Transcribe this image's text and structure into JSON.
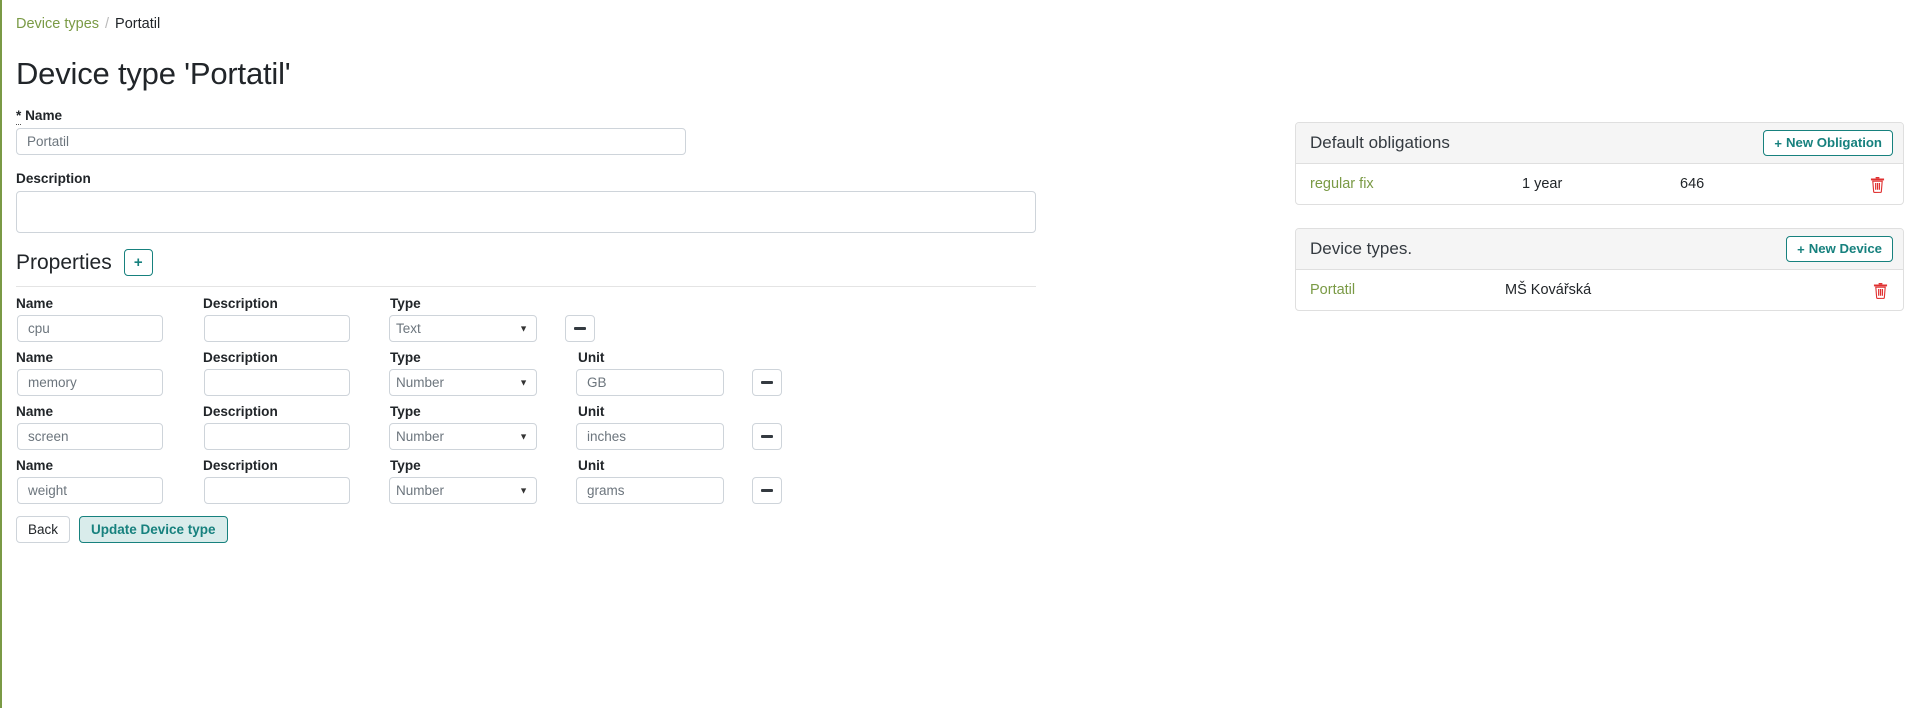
{
  "breadcrumb": {
    "root_label": "Device types",
    "separator": "/",
    "current_label": "Portatil"
  },
  "page_title": "Device type 'Portatil'",
  "form": {
    "name_label_star": "*",
    "name_label": "Name",
    "name_value": "Portatil",
    "description_label": "Description",
    "description_value": "",
    "properties_title": "Properties",
    "add_property_label": "+",
    "column_labels": {
      "name": "Name",
      "description": "Description",
      "type": "Type",
      "unit": "Unit"
    },
    "properties": [
      {
        "name": "cpu",
        "description": "",
        "type": "Text",
        "has_unit": false,
        "unit": ""
      },
      {
        "name": "memory",
        "description": "",
        "type": "Number",
        "has_unit": true,
        "unit": "GB"
      },
      {
        "name": "screen",
        "description": "",
        "type": "Number",
        "has_unit": true,
        "unit": "inches"
      },
      {
        "name": "weight",
        "description": "",
        "type": "Number",
        "has_unit": true,
        "unit": "grams"
      }
    ],
    "type_options": [
      "Text",
      "Number"
    ],
    "remove_property_label": "−",
    "back_label": "Back",
    "update_label": "Update Device type"
  },
  "cards": {
    "obligations": {
      "title": "Default obligations",
      "action_label": "New Obligation",
      "action_plus": "+",
      "rows": [
        {
          "name": "regular fix",
          "period": "1 year",
          "amount": "646"
        }
      ]
    },
    "devices": {
      "title": "Device types.",
      "action_label": "New Device",
      "action_plus": "+",
      "rows": [
        {
          "name": "Portatil",
          "owner": "MŠ Kovářská"
        }
      ]
    }
  },
  "colors": {
    "accent_green": "#7a9a45",
    "accent_teal": "#17817e",
    "danger_red": "#e03131",
    "card_header_bg": "#f5f5f5",
    "border": "#dfdfdf"
  }
}
